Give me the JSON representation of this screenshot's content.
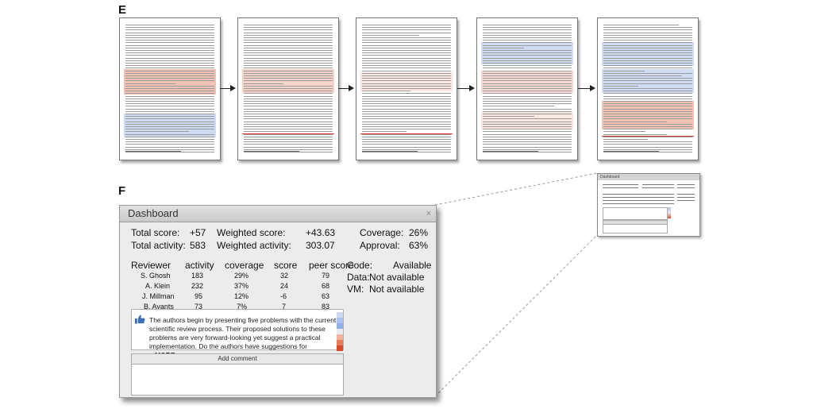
{
  "labels": {
    "panel_e": "E",
    "panel_f": "F"
  },
  "thumbnail": {
    "title": "Dashboard"
  },
  "dashboard": {
    "title": "Dashboard",
    "total_score_label": "Total score:",
    "total_score": "+57",
    "total_activity_label": "Total activity:",
    "total_activity": "583",
    "weighted_score_label": "Weighted score:",
    "weighted_score": "+43.63",
    "weighted_activity_label": "Weighted activity:",
    "weighted_activity": "303.07",
    "coverage_label": "Coverage:",
    "coverage": "26%",
    "approval_label": "Approval:",
    "approval": "63%",
    "columns": [
      "Reviewer",
      "activity",
      "coverage",
      "score",
      "peer score"
    ],
    "rows": [
      {
        "name": "S. Ghosh",
        "activity": "183",
        "coverage": "29%",
        "score": "32",
        "peer": "79"
      },
      {
        "name": "A. Klein",
        "activity": "232",
        "coverage": "37%",
        "score": "24",
        "peer": "68"
      },
      {
        "name": "J. Millman",
        "activity": "95",
        "coverage": "12%",
        "score": "-6",
        "peer": "63"
      },
      {
        "name": "B. Avants",
        "activity": "73",
        "coverage": "7%",
        "score": "7",
        "peer": "83"
      }
    ],
    "availability": [
      {
        "label": "Code:",
        "value": "Available"
      },
      {
        "label": "Data:",
        "value": "Not available"
      },
      {
        "label": "VM:",
        "value": "Not available"
      }
    ],
    "comment_line1": "The authors begin by presenting five problems with the current",
    "comment_line2": "scientific review process. Their proposed solutions to these",
    "comment_line3": "problems are very forward-looking yet suggest a practical",
    "comment_line4": "implementation.  Do the authors have suggestions for ...",
    "more_link": "MORE...",
    "add_comment_label": "Add comment"
  },
  "colors": {
    "highlight_red": "#f2c2b4",
    "highlight_blue": "#cfdcf3",
    "heat_scale": [
      "#c8d8f2",
      "#a9c2ee",
      "#8fb0e8",
      "#e9e9ef",
      "#f2b29c",
      "#ea7a58",
      "#d94a2a"
    ]
  }
}
